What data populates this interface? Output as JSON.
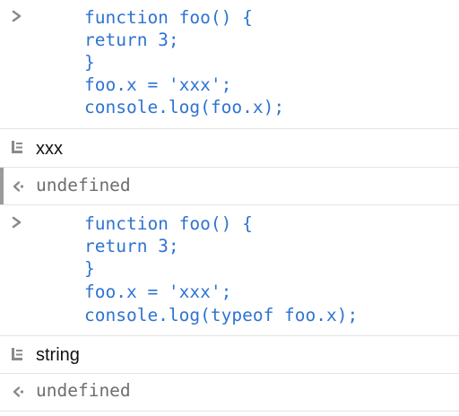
{
  "console": {
    "entries": [
      {
        "kind": "input",
        "lines": [
          "function foo() {",
          "return 3;",
          "}",
          "foo.x = 'xxx';",
          "console.log(foo.x);"
        ]
      },
      {
        "kind": "log",
        "text": "xxx"
      },
      {
        "kind": "result",
        "text": "undefined"
      },
      {
        "kind": "input",
        "lines": [
          "function foo() {",
          "return 3;",
          "}",
          "foo.x = 'xxx';",
          "console.log(typeof foo.x);"
        ]
      },
      {
        "kind": "log",
        "text": "string"
      },
      {
        "kind": "result",
        "text": "undefined"
      }
    ]
  },
  "colors": {
    "code": "#2f74d0",
    "log_text": "#111111",
    "result_text": "#6e6e6e",
    "icon": "#8a8a8a",
    "separator": "#e3e3e3"
  },
  "icons": {
    "input_prompt": "chevron-right-icon",
    "log_entry": "log-entry-icon",
    "result_return": "return-arrow-icon"
  }
}
